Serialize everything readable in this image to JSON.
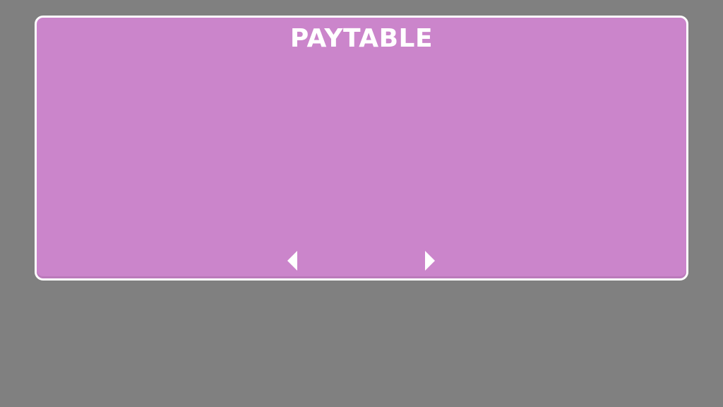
{
  "paytable": {
    "title": "PAYTABLE",
    "prev_icon": "triangle-left-icon",
    "next_icon": "triangle-right-icon"
  },
  "colors": {
    "background": "#808080",
    "panel": "#cb85cb",
    "panel_border": "#ffffff",
    "text": "#ffffff"
  }
}
